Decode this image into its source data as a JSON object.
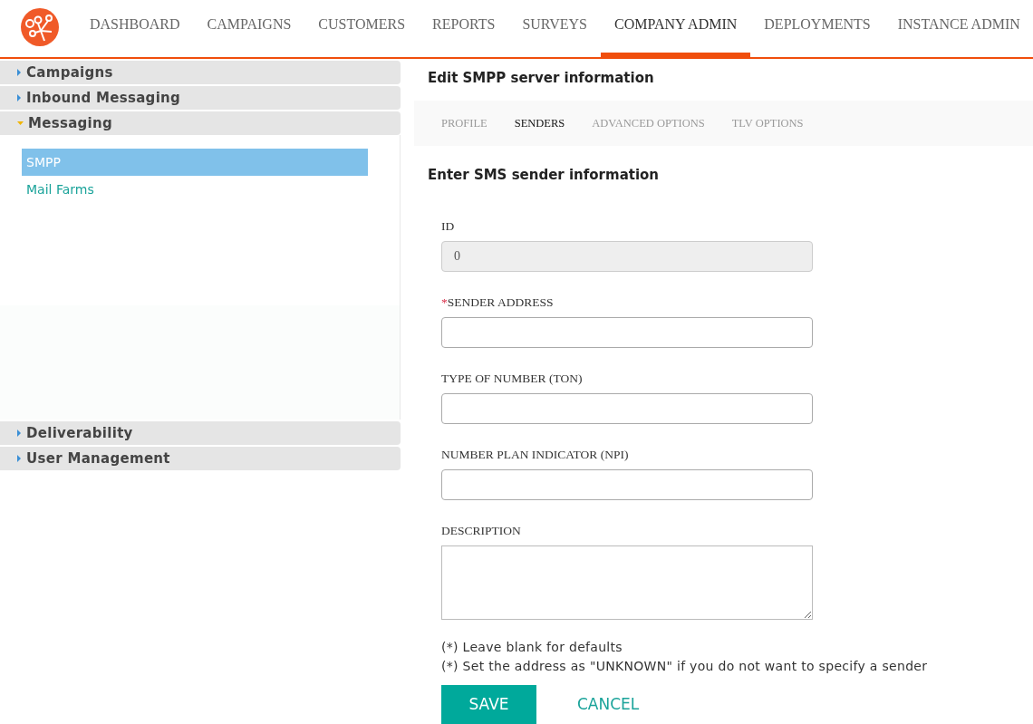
{
  "nav": [
    {
      "label": "DASHBOARD",
      "selected": false
    },
    {
      "label": "CAMPAIGNS",
      "selected": false
    },
    {
      "label": "CUSTOMERS",
      "selected": false
    },
    {
      "label": "REPORTS",
      "selected": false
    },
    {
      "label": "SURVEYS",
      "selected": false
    },
    {
      "label": "COMPANY ADMIN",
      "selected": true
    },
    {
      "label": "DEPLOYMENTS",
      "selected": false
    },
    {
      "label": "INSTANCE ADMIN",
      "selected": false
    }
  ],
  "sidebar": {
    "sections": [
      {
        "label": "Campaigns",
        "expanded": false
      },
      {
        "label": "Inbound Messaging",
        "expanded": false
      },
      {
        "label": "Messaging",
        "expanded": true,
        "children": [
          {
            "label": "SMPP",
            "selected": true
          },
          {
            "label": "Mail Farms",
            "selected": false
          }
        ]
      },
      {
        "label": "Deliverability",
        "expanded": false
      },
      {
        "label": "User Management",
        "expanded": false
      }
    ]
  },
  "title": "Edit SMPP server information",
  "tabs": [
    {
      "label": "PROFILE",
      "selected": false
    },
    {
      "label": "SENDERS",
      "selected": true
    },
    {
      "label": "ADVANCED OPTIONS",
      "selected": false
    },
    {
      "label": "TLV OPTIONS",
      "selected": false
    }
  ],
  "subtitle": "Enter SMS sender information",
  "fields": [
    {
      "kind": "input",
      "label": "ID",
      "value": "0",
      "disabled": true,
      "required": false
    },
    {
      "kind": "input",
      "label": "SENDER ADDRESS",
      "required": true,
      "disabled": false
    },
    {
      "kind": "input",
      "label": "TYPE OF NUMBER (TON)",
      "required": false,
      "disabled": false
    },
    {
      "kind": "input",
      "label": "NUMBER PLAN INDICATOR (NPI)",
      "required": false,
      "disabled": false
    },
    {
      "kind": "textarea",
      "label": "DESCRIPTION",
      "required": false,
      "disabled": false
    }
  ],
  "required_mark": "*",
  "notes": [
    "(*) Leave blank for defaults",
    "(*) Set the address as \"UNKNOWN\" if you do not want to specify a sender"
  ],
  "buttons": {
    "save": "SAVE",
    "cancel": "CANCEL"
  }
}
